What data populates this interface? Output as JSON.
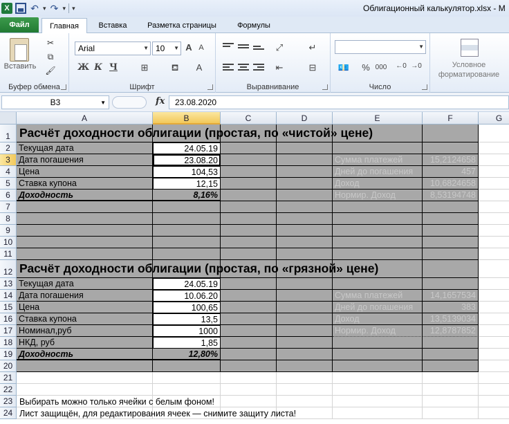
{
  "window": {
    "title": "Облигационный калькулятор.xlsx - M",
    "qat": {
      "app_icon": "X"
    }
  },
  "tabs": [
    "Файл",
    "Главная",
    "Вставка",
    "Разметка страницы",
    "Формулы"
  ],
  "ribbon": {
    "clipboard": {
      "paste_label": "Вставить",
      "group_label": "Буфер обмена"
    },
    "font": {
      "font_name": "Arial",
      "font_size": "10",
      "group_label": "Шрифт",
      "bold": "Ж",
      "italic": "К",
      "underline": "Ч",
      "grow": "A",
      "shrink": "A",
      "font_color": "A"
    },
    "alignment": {
      "group_label": "Выравнивание"
    },
    "number": {
      "group_label": "Число",
      "format": "",
      "percent": "%",
      "comma": "000"
    },
    "styles": {
      "cond_format_line1": "Условное",
      "cond_format_line2": "форматирование"
    }
  },
  "formula_bar": {
    "name_box": "B3",
    "fx": "fx",
    "formula": "23.08.2020"
  },
  "columns": [
    "A",
    "B",
    "C",
    "D",
    "E",
    "F",
    "G"
  ],
  "rows": [
    "1",
    "2",
    "3",
    "4",
    "5",
    "6",
    "7",
    "8",
    "9",
    "10",
    "11",
    "12",
    "13",
    "14",
    "15",
    "16",
    "17",
    "18",
    "19",
    "20",
    "21",
    "22",
    "23",
    "24"
  ],
  "section1": {
    "title": "Расчёт доходности облигации (простая, по «чистой» цене)",
    "labels": [
      "Текущая дата",
      "Дата погашения",
      "Цена",
      "Ставка купона",
      "Доходность"
    ],
    "values": [
      "24.05.19",
      "23.08.20",
      "104,53",
      "12,15",
      "8,16%"
    ],
    "stat_labels": [
      "Сумма платежей",
      "Дней до погашения",
      "Доход",
      "Нормир. Доход"
    ],
    "stat_values": [
      "15,2124658",
      "457",
      "10,6824658",
      "8,53194748"
    ]
  },
  "section2": {
    "title": "Расчёт доходности облигации (простая, по «грязной» цене)",
    "labels": [
      "Текущая дата",
      "Дата погашения",
      "Цена",
      "Ставка купона",
      "Номинал,руб",
      "НКД, руб",
      "Доходность"
    ],
    "values": [
      "24.05.19",
      "10.06.20",
      "100,65",
      "13,5",
      "1000",
      "1,85",
      "12,80%"
    ],
    "stat_labels": [
      "Сумма платежей",
      "Дней до погашения",
      "Доход",
      "Нормир. Доход"
    ],
    "stat_values": [
      "14,1657534",
      "383",
      "13,5139034",
      "12,8787852"
    ]
  },
  "notes": [
    "Выбирать можно только ячейки с белым фоном!",
    "Лист защищён, для редактирования ячеек — снимите защиту листа!"
  ]
}
